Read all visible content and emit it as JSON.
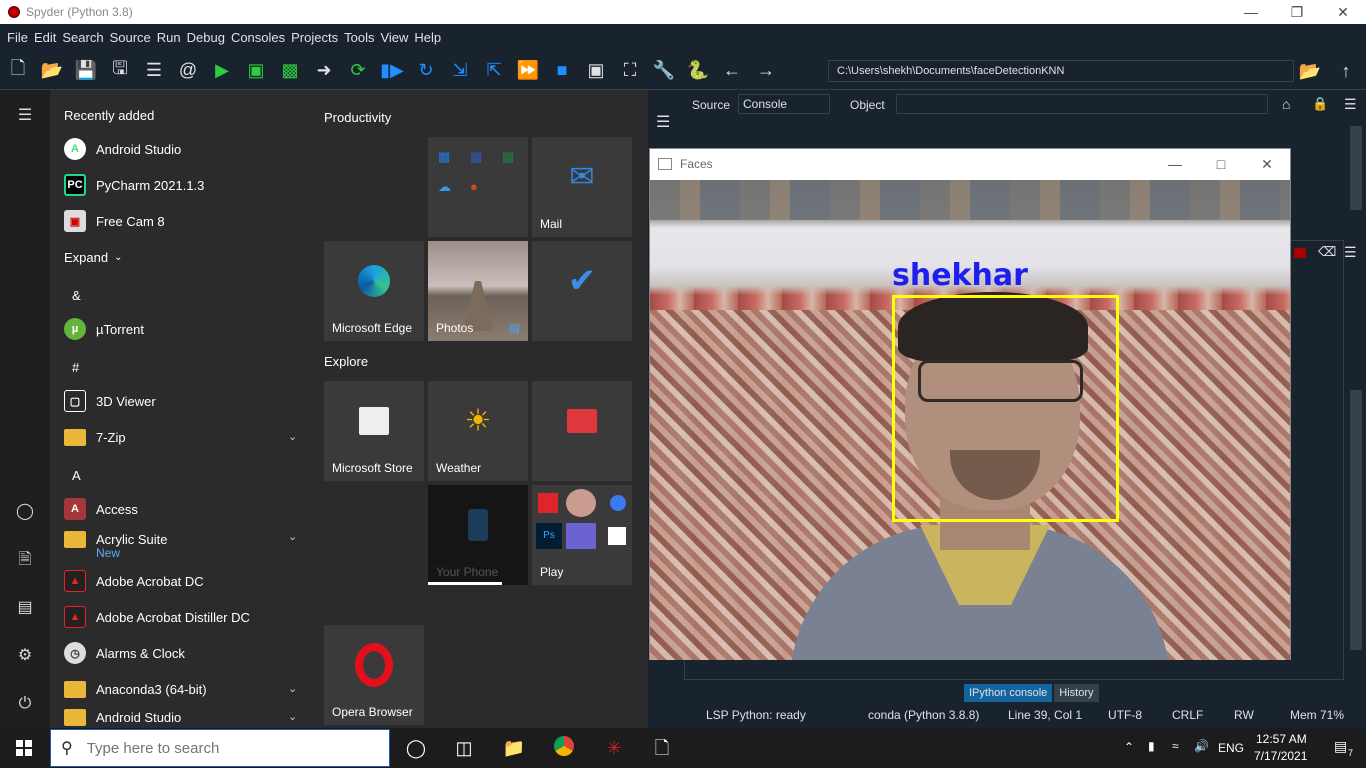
{
  "spyder": {
    "title": "Spyder (Python 3.8)",
    "menu": [
      "File",
      "Edit",
      "Search",
      "Source",
      "Run",
      "Debug",
      "Consoles",
      "Projects",
      "Tools",
      "View",
      "Help"
    ],
    "path": "C:\\Users\\shekh\\Documents\\faceDetectionKNN",
    "source_label": "Source",
    "source_value": "Console",
    "object_label": "Object",
    "tabs": [
      "IPython console",
      "History"
    ],
    "status": {
      "lsp": "LSP Python: ready",
      "conda": "conda (Python 3.8.8)",
      "position": "Line 39, Col 1",
      "encoding": "UTF-8",
      "eol": "CRLF",
      "rw": "RW",
      "mem": "Mem 71%"
    }
  },
  "faces_window": {
    "title": "Faces",
    "detected_name": "shekhar"
  },
  "start_menu": {
    "recently_added": "Recently added",
    "expand": "Expand",
    "apps": [
      {
        "label": "Android Studio"
      },
      {
        "label": "PyCharm 2021.1.3"
      },
      {
        "label": "Free Cam 8"
      },
      {
        "label": "µTorrent"
      },
      {
        "label": "3D Viewer"
      },
      {
        "label": "7-Zip"
      },
      {
        "label": "Access"
      },
      {
        "label": "Acrylic Suite",
        "sub": "New"
      },
      {
        "label": "Adobe Acrobat DC"
      },
      {
        "label": "Adobe Acrobat Distiller DC"
      },
      {
        "label": "Alarms & Clock"
      },
      {
        "label": "Anaconda3 (64-bit)"
      },
      {
        "label": "Android Studio"
      }
    ],
    "letters": [
      "&",
      "#",
      "A"
    ],
    "sections": [
      "Productivity",
      "Explore"
    ],
    "tiles": {
      "mail": "Mail",
      "edge": "Microsoft Edge",
      "photos": "Photos",
      "store": "Microsoft Store",
      "weather": "Weather",
      "phone": "Your Phone",
      "play": "Play",
      "opera": "Opera Browser"
    }
  },
  "taskbar": {
    "search_placeholder": "Type here to search",
    "lang": "ENG",
    "time": "12:57 AM",
    "date": "7/17/2021",
    "notifications": "7"
  }
}
